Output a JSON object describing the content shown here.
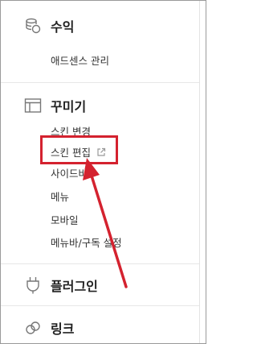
{
  "sections": {
    "revenue": {
      "label": "수익",
      "icon": "coins-icon",
      "items": [
        "애드센스 관리"
      ]
    },
    "customize": {
      "label": "꾸미기",
      "icon": "layout-icon",
      "items": [
        "스킨 변경",
        "스킨 편집",
        "사이드바",
        "메뉴",
        "모바일",
        "메뉴바/구독 설정"
      ]
    },
    "plugin": {
      "label": "플러그인",
      "icon": "plug-icon"
    },
    "link": {
      "label": "링크",
      "icon": "link-icon"
    }
  },
  "annotation": {
    "highlight_color": "#d4222f",
    "arrow_color": "#d4222f",
    "external_link_icon": "external-link-icon"
  }
}
